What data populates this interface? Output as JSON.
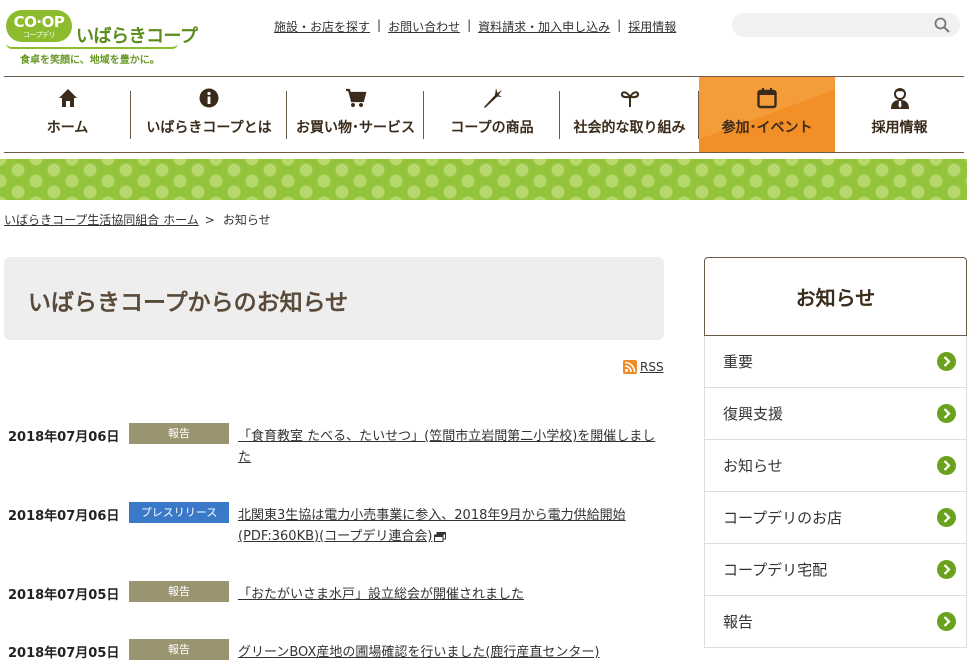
{
  "header": {
    "logo_mark": "CO·OP",
    "logo_mark_sub": "コープデリ",
    "brand_name": "いばらきコープ",
    "tagline": "食卓を笑顔に、地域を豊かに。",
    "top_links": [
      "施設・お店を探す",
      "お問い合わせ",
      "資料請求・加入申し込み",
      "採用情報"
    ],
    "search": {
      "placeholder": ""
    }
  },
  "nav": {
    "items": [
      {
        "label": "ホーム",
        "icon": "home-icon"
      },
      {
        "label": "いばらきコープとは",
        "icon": "info-icon"
      },
      {
        "label": "お買い物･サービス",
        "icon": "cart-icon"
      },
      {
        "label": "コープの商品",
        "icon": "carrot-icon"
      },
      {
        "label": "社会的な取り組み",
        "icon": "sprout-icon"
      },
      {
        "label": "参加･イベント",
        "icon": "calendar-icon",
        "active": true
      },
      {
        "label": "採用情報",
        "icon": "person-icon"
      }
    ]
  },
  "breadcrumb": {
    "home": "いばらきコープ生活協同組合 ホーム",
    "current": "お知らせ"
  },
  "main": {
    "title": "いばらきコープからのお知らせ",
    "rss_label": "RSS",
    "news": [
      {
        "date": "2018年07月06日",
        "category": "報告",
        "type": "report",
        "title": "「食育教室 たべる、たいせつ」(笠間市立岩間第二小学校)を開催しました",
        "external": false
      },
      {
        "date": "2018年07月06日",
        "category": "プレスリリース",
        "type": "press",
        "title": "北関東3生協は電力小売事業に参入、2018年9月から電力供給開始(PDF:360KB)(コープデリ連合会)",
        "external": true
      },
      {
        "date": "2018年07月05日",
        "category": "報告",
        "type": "report",
        "title": "「おたがいさま水戸」設立総会が開催されました",
        "external": false
      },
      {
        "date": "2018年07月05日",
        "category": "報告",
        "type": "report",
        "title": "グリーンBOX産地の圃場確認を行いました(鹿行産直センター)",
        "external": false
      }
    ]
  },
  "sidebar": {
    "heading": "お知らせ",
    "items": [
      "重要",
      "復興支援",
      "お知らせ",
      "コープデリのお店",
      "コープデリ宅配",
      "報告"
    ]
  },
  "colors": {
    "accent_green": "#94c43c",
    "nav_active_orange": "#f59c3a",
    "badge_report": "#9b9470",
    "badge_press": "#3a78c8",
    "arrow_green": "#6aa21e"
  }
}
